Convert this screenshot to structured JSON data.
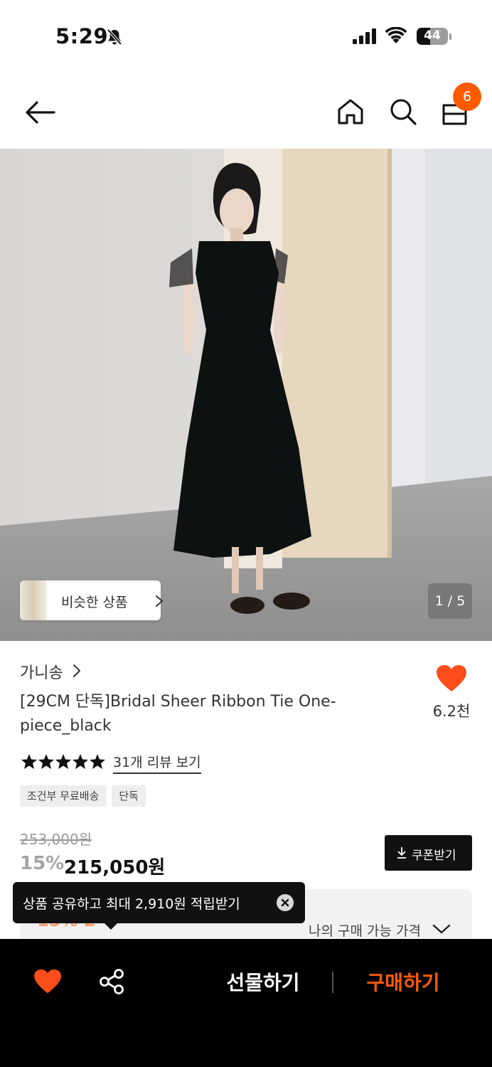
{
  "status_bar": {
    "time": "5:29",
    "battery": "44",
    "battery_level": 0.44
  },
  "header": {
    "cart_count": "6"
  },
  "gallery": {
    "similar_label": "비슷한 상품",
    "page_indicator": "1 / 5"
  },
  "product": {
    "brand": "가니송",
    "title": "[29CM 단독]Bridal Sheer Ribbon Tie One-piece_black",
    "like_count": "6.2천",
    "rating_stars": 5,
    "review_link": "31개 리뷰 보기",
    "tags": [
      "조건부 무료배송",
      "단독"
    ],
    "original_price": "253,000원",
    "discount": "15%",
    "sale_price": "215,050원",
    "coupon_label": "쿠폰받기"
  },
  "my_price": {
    "label": "나의 구매 가능 가격"
  },
  "toast": {
    "text": "상품 공유하고 최대 2,910원 적립받기"
  },
  "bottom_bar": {
    "gift_label": "선물하기",
    "buy_label": "구매하기"
  },
  "colors": {
    "accent": "#ff5a00",
    "like": "#ff4d1a",
    "bottom_bar_bg": "#000000"
  },
  "icons": [
    "bell-slash-icon",
    "signal-icon",
    "wifi-icon",
    "back-arrow-icon",
    "home-icon",
    "search-icon",
    "shopping-bag-icon",
    "chevron-right-icon",
    "heart-icon",
    "star-icon",
    "download-icon",
    "chevron-down-icon",
    "close-icon",
    "share-icon"
  ]
}
